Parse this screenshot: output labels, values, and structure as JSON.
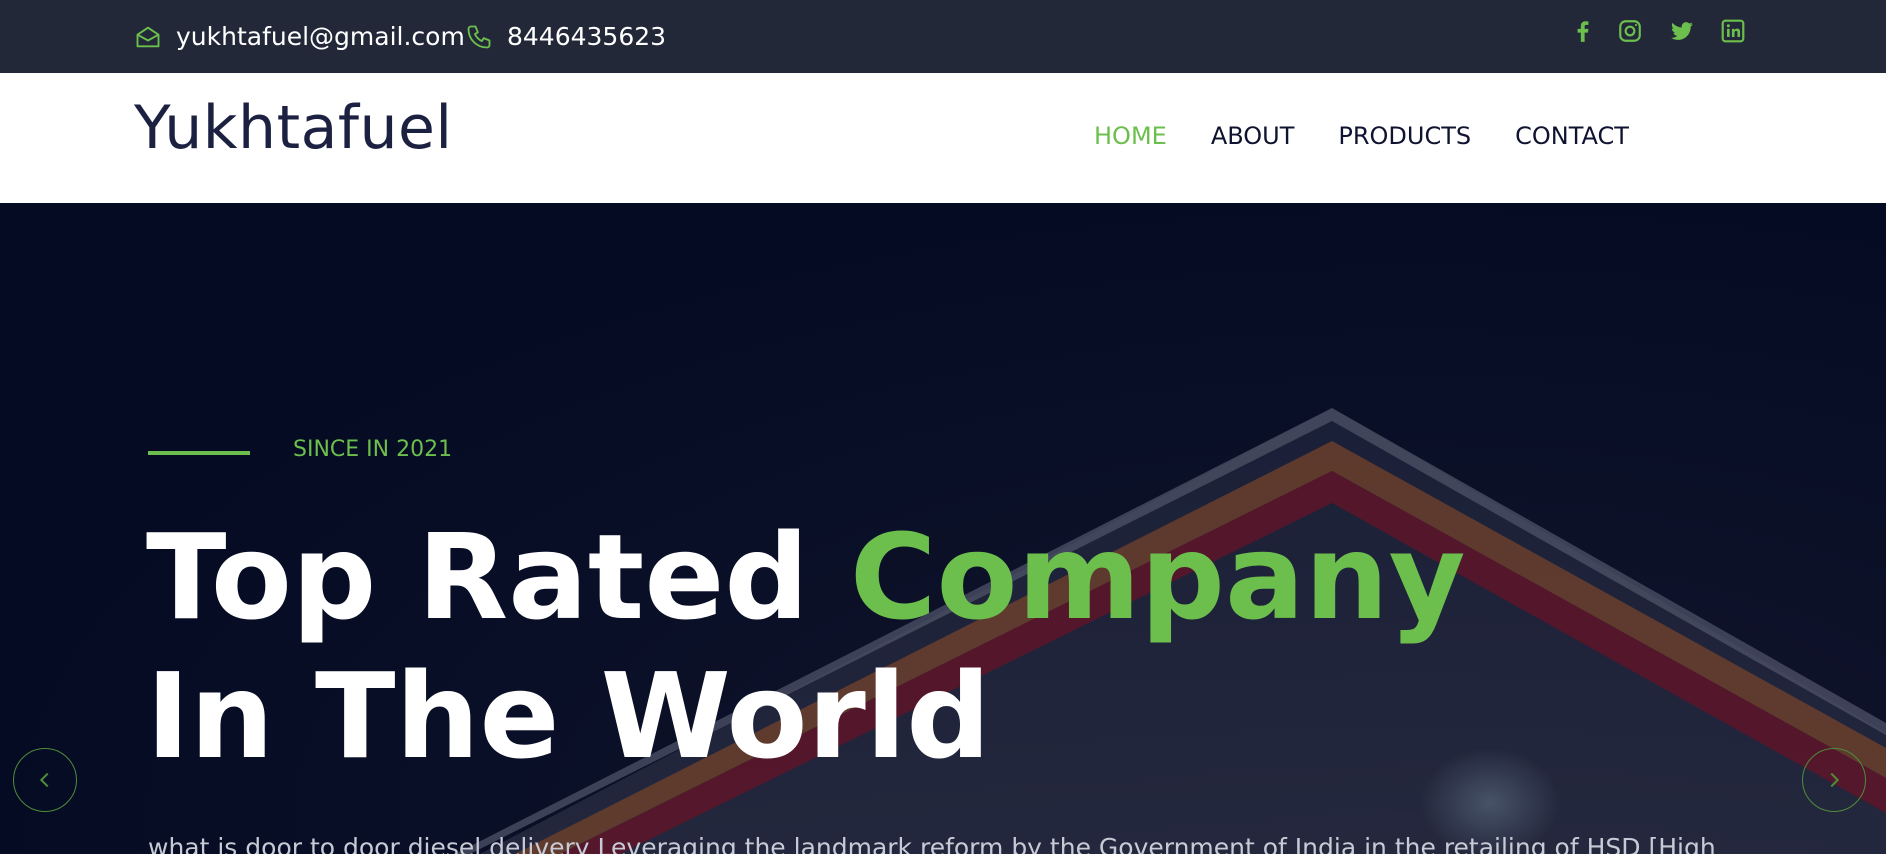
{
  "topbar": {
    "email": "yukhtafuel@gmail.com",
    "phone": "8446435623",
    "email_icon": "envelope-open-icon",
    "phone_icon": "phone-icon",
    "social": [
      "facebook-icon",
      "instagram-icon",
      "twitter-icon",
      "linkedin-icon"
    ]
  },
  "header": {
    "logo": "Yukhtafuel",
    "nav": [
      {
        "label": "HOME",
        "active": true
      },
      {
        "label": "ABOUT",
        "active": false
      },
      {
        "label": "PRODUCTS",
        "active": false
      },
      {
        "label": "CONTACT",
        "active": false
      }
    ]
  },
  "hero": {
    "since": "SINCE IN 2021",
    "headline_part1": "Top Rated ",
    "headline_highlight": "Company",
    "headline_line2": "In The World",
    "description": "what is door to door diesel delivery Leveraging the landmark reform by the Government of India in the retailing of HSD [High",
    "prev_icon": "chevron-left-icon",
    "next_icon": "chevron-right-icon"
  },
  "colors": {
    "accent": "#6cbf4c",
    "topbar_bg": "#232839",
    "hero_bg": "#050c24",
    "logo_text": "#1c2142"
  }
}
